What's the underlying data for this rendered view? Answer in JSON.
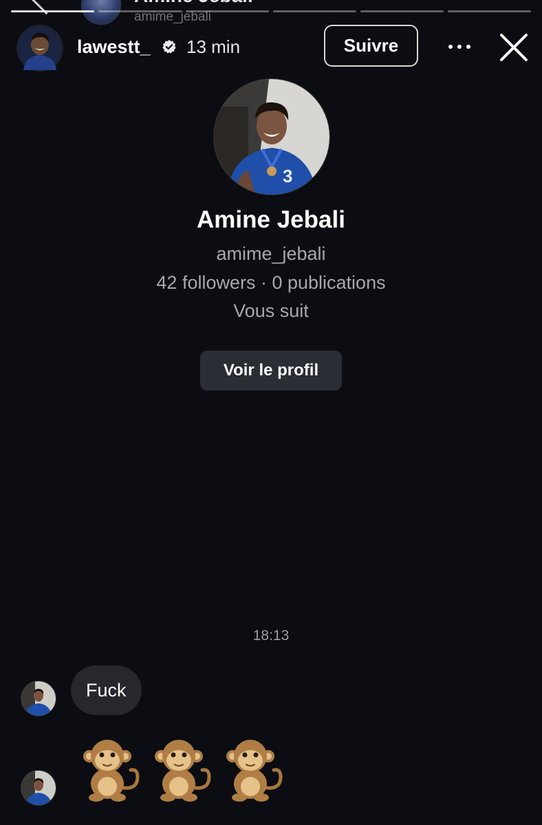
{
  "background_story": {
    "title": "Amine Jebali",
    "subtitle": "amime_jebali",
    "progress_segments_total": 6,
    "progress_segments_done": 1
  },
  "header": {
    "username": "lawestt_",
    "verified_icon": "verified-badge-icon",
    "time_ago": "13 min",
    "follow_label": "Suivre",
    "more_icon": "more-horizontal-icon",
    "close_icon": "close-icon"
  },
  "profile": {
    "name": "Amine Jebali",
    "handle": "amime_jebali",
    "stats": "42 followers · 0 publications",
    "follows_you": "Vous suit",
    "view_profile_label": "Voir le profil"
  },
  "messages": {
    "timestamp": "18:13",
    "items": [
      {
        "type": "text",
        "text": "Fuck"
      },
      {
        "type": "emoji",
        "text": "🐒🐒🐒",
        "icons": [
          "monkey-icon",
          "monkey-icon",
          "monkey-icon"
        ]
      }
    ]
  },
  "colors": {
    "background": "#0b0d12",
    "bubble": "#26282e",
    "button": "#2a2d33",
    "secondary_text": "#a5a8ae"
  }
}
